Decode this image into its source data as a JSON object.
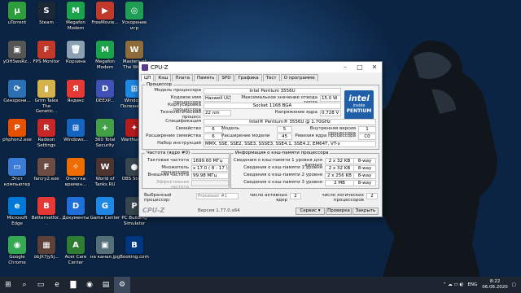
{
  "desktop": {
    "icons": [
      {
        "label": "uTorrent",
        "glyph": "µ",
        "color": "#2e9e3c"
      },
      {
        "label": "Steam",
        "glyph": "S",
        "color": "#1b2838"
      },
      {
        "label": "Megafon Modem",
        "glyph": "M",
        "color": "#1aa34a"
      },
      {
        "label": "FreeMovie...",
        "glyph": "▶",
        "color": "#c0392b"
      },
      {
        "label": "Ускорение игр",
        "glyph": "◎",
        "color": "#1f9d55"
      },
      {
        "label": "yOHSwsRz...",
        "glyph": "▣",
        "color": "#555555"
      },
      {
        "label": "FPS Monitor",
        "glyph": "F",
        "color": "#c0392b"
      },
      {
        "label": "Корзина",
        "glyph": "🗑",
        "color": "#8aa1b4"
      },
      {
        "label": "Megafon Modem",
        "glyph": "M",
        "color": "#1aa34a"
      },
      {
        "label": "Masters of The World",
        "glyph": "W",
        "color": "#8e6b3a"
      },
      {
        "label": "Синхрони...",
        "glyph": "⟳",
        "color": "#2b6fb5"
      },
      {
        "label": "Grim Tales The Genetic...",
        "glyph": "▮",
        "color": "#d4b24c"
      },
      {
        "label": "Яндекс",
        "glyph": "Я",
        "color": "#e53935"
      },
      {
        "label": "DEEXP...",
        "glyph": "D",
        "color": "#3f51b5"
      },
      {
        "label": "Windows Полезные...",
        "glyph": "⊞",
        "color": "#1e88e5"
      },
      {
        "label": "phphon2.exe",
        "glyph": "P",
        "color": "#e65100"
      },
      {
        "label": "Radeon Settings",
        "glyph": "R",
        "color": "#c62828"
      },
      {
        "label": "Windows...",
        "glyph": "⊞",
        "color": "#1565c0"
      },
      {
        "label": "360 Total Security",
        "glyph": "+",
        "color": "#43a047"
      },
      {
        "label": "Warthunder",
        "glyph": "✦",
        "color": "#b71c1c"
      },
      {
        "label": "Этот компьютер",
        "glyph": "▭",
        "color": "#3a7bd5"
      },
      {
        "label": "farcry2.exe",
        "glyph": "F",
        "color": "#6d4c41"
      },
      {
        "label": "Очистка времен...",
        "glyph": "✧",
        "color": "#ef6c00"
      },
      {
        "label": "World of Tanks RU",
        "glyph": "W",
        "color": "#4e342e"
      },
      {
        "label": "OBS Studio",
        "glyph": "●",
        "color": "#37474f"
      },
      {
        "label": "Microsoft Edge",
        "glyph": "e",
        "color": "#0078d7"
      },
      {
        "label": "Betternetfor...",
        "glyph": "B",
        "color": "#e53935"
      },
      {
        "label": "Документы",
        "glyph": "D",
        "color": "#1e6fd9"
      },
      {
        "label": "Game Center",
        "glyph": "G",
        "color": "#1e88e5"
      },
      {
        "label": "PC Building Simulator",
        "glyph": "P",
        "color": "#37474f"
      },
      {
        "label": "Google Chrome",
        "glyph": "◉",
        "color": "#34a853"
      },
      {
        "label": "obJX7jy5j...",
        "glyph": "▦",
        "color": "#5d4037"
      },
      {
        "label": "Acer Care Center",
        "glyph": "A",
        "color": "#2e7d32"
      },
      {
        "label": "на канал.jpg",
        "glyph": "▣",
        "color": "#546e7a"
      },
      {
        "label": "Booking.com",
        "glyph": "B",
        "color": "#003580"
      }
    ]
  },
  "window": {
    "title": "CPU-Z",
    "tabs": [
      "ЦП",
      "Кэш",
      "Плата",
      "Память",
      "SPD",
      "Графика",
      "Тест",
      "О программе"
    ],
    "processor": {
      "legend": "Процессор",
      "fields": [
        {
          "label": "Модель процессора",
          "value": "Intel Pentium 3556U"
        },
        {
          "label": "Кодовое имя процессора",
          "value": "Haswell ULT"
        },
        {
          "label": "Максимальное значение отвода тепла",
          "value": "15.0 W"
        },
        {
          "label": "Корпусировка процессора",
          "value": "Socket 1168 BGA"
        },
        {
          "label": "Технологический процесс",
          "value": "22 nm"
        },
        {
          "label": "Напряжение ядра",
          "value": "0.728 V"
        },
        {
          "label": "Спецификация",
          "value": "Intel® Pentium® 3556U @ 1.70GHz"
        },
        {
          "label": "Семейство",
          "value": "6"
        },
        {
          "label": "Модель",
          "value": "5"
        },
        {
          "label": "Внутренняя версия процессора",
          "value": "1"
        },
        {
          "label": "Расширение семейства",
          "value": "6"
        },
        {
          "label": "Расширение модели",
          "value": "45"
        },
        {
          "label": "Ревизия ядра процессора",
          "value": "C0"
        },
        {
          "label": "Набор инструкций",
          "value": "MMX, SSE, SSE2, SSE3, SSSE3, SSE4.1, SSE4.2, EM64T, VT-x"
        }
      ],
      "intel_logo": {
        "brand": "intel",
        "sub": "inside",
        "name": "PENTIUM"
      }
    },
    "clocks": {
      "legend": "Частота (ядро #0)",
      "fields": [
        {
          "label": "Тактовая частота",
          "value": "1699.60 МГц"
        },
        {
          "label": "Множитель процессора",
          "value": "x 17.0 ( 8 - 17 )"
        },
        {
          "label": "Внешняя частота",
          "value": "99.98 МГц"
        },
        {
          "label": "Эффективная частота",
          "value": ""
        }
      ]
    },
    "cache": {
      "legend": "Информация о кэш-памяти процессора",
      "rows": [
        {
          "label": "Сведения о кэш-памяти 1 уровня для данных",
          "size": "2 x 32 KB",
          "way": "8-way"
        },
        {
          "label": "Сведения о кэш-памяти 1 уровня",
          "size": "2 x 32 KB",
          "way": "8-way"
        },
        {
          "label": "Сведения о кэш-памяти 2 уровня",
          "size": "2 x 256 KB",
          "way": "8-way"
        },
        {
          "label": "Сведения о кэш-памяти 3 уровня",
          "size": "2 MB",
          "way": "8-way"
        }
      ]
    },
    "selection": {
      "label": "Выбранный процессор:",
      "value": "Processor #1",
      "cores_label": "число активных ядер",
      "cores": "2",
      "threads_label": "число логических процессоров",
      "threads": "2"
    },
    "footer": {
      "logo": "CPU-Z",
      "version": "Версия 1.77.0.x64",
      "service": "Сервис",
      "validate": "Проверка",
      "close": "Закрыть"
    }
  },
  "taskbar": {
    "icons": [
      "⊞",
      "⌕",
      "▭",
      "e",
      "▇",
      "◉",
      "▤",
      "⚙"
    ],
    "tray": {
      "lang": "ENG",
      "time": "8:22",
      "date": "06.06.2020"
    }
  }
}
